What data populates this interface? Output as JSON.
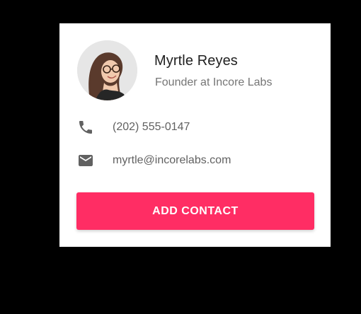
{
  "contact": {
    "name": "Myrtle Reyes",
    "title": "Founder at Incore Labs",
    "phone": "(202) 555-0147",
    "email": "myrtle@incorelabs.com"
  },
  "actions": {
    "add_label": "ADD CONTACT"
  },
  "icons": {
    "phone": "phone-icon",
    "email": "email-icon"
  },
  "colors": {
    "accent": "#ff2d64",
    "icon": "#616161",
    "background": "#000000",
    "card": "#ffffff"
  }
}
